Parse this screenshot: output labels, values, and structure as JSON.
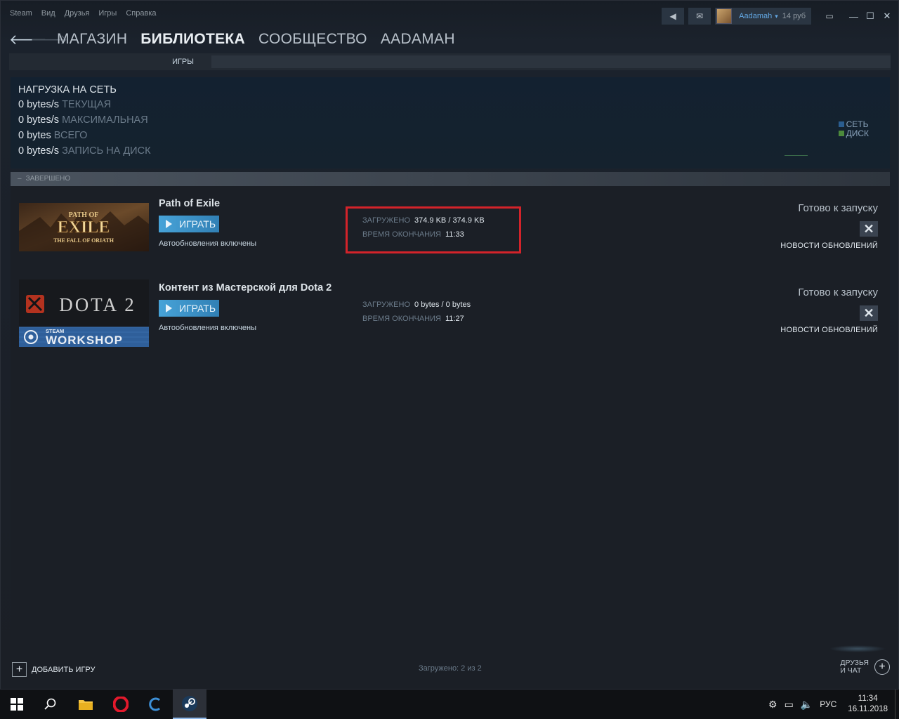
{
  "menu": [
    "Steam",
    "Вид",
    "Друзья",
    "Игры",
    "Справка"
  ],
  "user": {
    "name": "Aadamah",
    "wallet": "14 руб"
  },
  "nav": {
    "links": [
      "МАГАЗИН",
      "БИБЛИОТЕКА",
      "СООБЩЕСТВО",
      "AADAMAH"
    ],
    "active": "БИБЛИОТЕКА"
  },
  "subnav": {
    "tab": "ИГРЫ"
  },
  "network": {
    "title": "НАГРУЗКА НА СЕТЬ",
    "rows": [
      {
        "value": "0 bytes/s",
        "label": "ТЕКУЩАЯ"
      },
      {
        "value": "0 bytes/s",
        "label": "МАКСИМАЛЬНАЯ"
      },
      {
        "value": "0 bytes",
        "label": "ВСЕГО"
      },
      {
        "value": "0 bytes/s",
        "label": "ЗАПИСЬ НА ДИСК"
      }
    ],
    "legend": [
      {
        "label": "СЕТЬ",
        "color": "#2a5d8f"
      },
      {
        "label": "ДИСК",
        "color": "#4c8a3c"
      }
    ]
  },
  "section": {
    "label": "ЗАВЕРШЕНО"
  },
  "downloads": [
    {
      "name": "Path of Exile",
      "play_label": "ИГРАТЬ",
      "auto": "Автообновления включены",
      "downloaded_label": "ЗАГРУЖЕНО",
      "downloaded_value": "374.9 KB / 374.9 KB",
      "eta_label": "ВРЕМЯ ОКОНЧАНИЯ",
      "eta_value": "11:33",
      "status": "Готово к запуску",
      "news": "НОВОСТИ ОБНОВЛЕНИЙ",
      "thumb_text": {
        "line1": "PATH OF",
        "line2": "EXILE",
        "line3": "THE FALL OF ORIATH"
      }
    },
    {
      "name": "Контент из Мастерской для Dota 2",
      "play_label": "ИГРАТЬ",
      "auto": "Автообновления включены",
      "downloaded_label": "ЗАГРУЖЕНО",
      "downloaded_value": "0 bytes / 0 bytes",
      "eta_label": "ВРЕМЯ ОКОНЧАНИЯ",
      "eta_value": "11:27",
      "status": "Готово к запуску",
      "news": "НОВОСТИ ОБНОВЛЕНИЙ",
      "thumb_text": {
        "line1": "DOTA 2",
        "line2": "STEAM",
        "line3": "WORKSHOP"
      }
    }
  ],
  "footer": {
    "add_game": "ДОБАВИТЬ ИГРУ",
    "loaded": "Загружено: 2 из 2",
    "friends_line1": "ДРУЗЬЯ",
    "friends_line2": "И ЧАТ"
  },
  "taskbar": {
    "lang": "РУС",
    "time": "11:34",
    "date": "16.11.2018"
  },
  "colors": {
    "accent": "#47a3d8",
    "highlight": "#d3232a"
  }
}
